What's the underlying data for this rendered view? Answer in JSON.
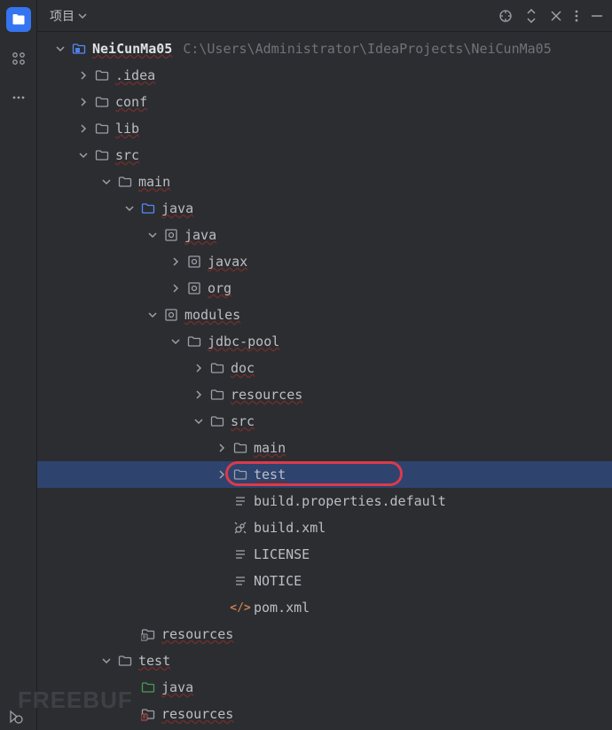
{
  "header": {
    "title": "项目"
  },
  "project": {
    "name": "NeiCunMa05",
    "path": "C:\\Users\\Administrator\\IdeaProjects\\NeiCunMa05"
  },
  "tree": [
    {
      "depth": 0,
      "chev": "down",
      "icon": "module",
      "labelKey": "project.name",
      "bold": true,
      "pathKey": "project.path",
      "wave": true
    },
    {
      "depth": 1,
      "chev": "right",
      "icon": "folder",
      "label": ".idea",
      "wave": true
    },
    {
      "depth": 1,
      "chev": "right",
      "icon": "folder",
      "label": "conf",
      "wave": true
    },
    {
      "depth": 1,
      "chev": "right",
      "icon": "folder",
      "label": "lib",
      "wave": true
    },
    {
      "depth": 1,
      "chev": "down",
      "icon": "folder",
      "label": "src",
      "wave": true
    },
    {
      "depth": 2,
      "chev": "down",
      "icon": "folder",
      "label": "main",
      "wave": true
    },
    {
      "depth": 3,
      "chev": "down",
      "icon": "folder-blue",
      "label": "java",
      "wave": true
    },
    {
      "depth": 4,
      "chev": "down",
      "icon": "package",
      "label": "java",
      "wave": true
    },
    {
      "depth": 5,
      "chev": "right",
      "icon": "package",
      "label": "javax",
      "wave": true
    },
    {
      "depth": 5,
      "chev": "right",
      "icon": "package",
      "label": "org",
      "wave": true
    },
    {
      "depth": 4,
      "chev": "down",
      "icon": "package",
      "label": "modules",
      "wave": true
    },
    {
      "depth": 5,
      "chev": "down",
      "icon": "folder",
      "label": "jdbc-pool",
      "wave": true
    },
    {
      "depth": 6,
      "chev": "right",
      "icon": "folder",
      "label": "doc",
      "wave": true
    },
    {
      "depth": 6,
      "chev": "right",
      "icon": "folder",
      "label": "resources",
      "wave": true
    },
    {
      "depth": 6,
      "chev": "down",
      "icon": "folder",
      "label": "src",
      "wave": true
    },
    {
      "depth": 7,
      "chev": "right",
      "icon": "folder",
      "label": "main",
      "wave": true
    },
    {
      "depth": 7,
      "chev": "right",
      "icon": "folder",
      "label": "test",
      "wave": true,
      "selected": true,
      "highlight": true
    },
    {
      "depth": 7,
      "chev": "none",
      "icon": "lines",
      "label": "build.properties.default"
    },
    {
      "depth": 7,
      "chev": "none",
      "icon": "ant",
      "label": "build.xml"
    },
    {
      "depth": 7,
      "chev": "none",
      "icon": "lines",
      "label": "LICENSE"
    },
    {
      "depth": 7,
      "chev": "none",
      "icon": "lines",
      "label": "NOTICE"
    },
    {
      "depth": 7,
      "chev": "none",
      "icon": "xml",
      "label": "pom.xml"
    },
    {
      "depth": 3,
      "chev": "none",
      "icon": "res-folder",
      "label": "resources",
      "wave": true
    },
    {
      "depth": 2,
      "chev": "down",
      "icon": "folder",
      "label": "test",
      "wave": true
    },
    {
      "depth": 3,
      "chev": "none",
      "icon": "folder-green",
      "label": "java",
      "wave": true
    },
    {
      "depth": 3,
      "chev": "none",
      "icon": "res-folder-test",
      "label": "resources",
      "wave": true
    }
  ],
  "watermark": "FREEBUF"
}
